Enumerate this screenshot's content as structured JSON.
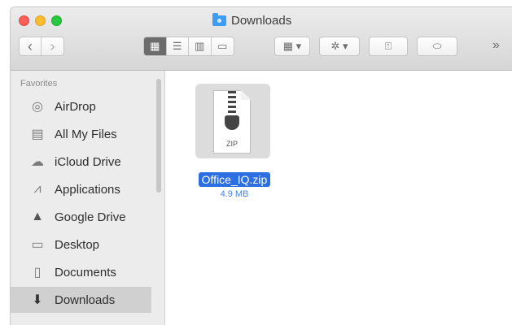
{
  "window": {
    "title": "Downloads"
  },
  "toolbar": {
    "back_icon": "chevron-left-icon",
    "forward_icon": "chevron-right-icon",
    "view_modes": [
      "icon-view",
      "list-view",
      "column-view",
      "cover-flow-view"
    ],
    "active_view": "icon-view",
    "overflow_icon": "double-chevron-right-icon",
    "glyphs": {
      "back": "‹",
      "forward": "›",
      "icon_view": "▦",
      "list_view": "☰",
      "column_view": "▥",
      "cover_view": "▭",
      "group": "▦ ▾",
      "action": "✲ ▾",
      "share": "⍐",
      "tag": "⬭",
      "overflow": "»"
    }
  },
  "sidebar": {
    "heading": "Favorites",
    "items": [
      {
        "label": "AirDrop",
        "icon": "airdrop-icon",
        "glyph": "◎"
      },
      {
        "label": "All My Files",
        "icon": "all-files-icon",
        "glyph": "▤"
      },
      {
        "label": "iCloud Drive",
        "icon": "cloud-icon",
        "glyph": "☁"
      },
      {
        "label": "Applications",
        "icon": "applications-icon",
        "glyph": "⩘"
      },
      {
        "label": "Google Drive",
        "icon": "google-drive-icon",
        "glyph": "▲"
      },
      {
        "label": "Desktop",
        "icon": "desktop-icon",
        "glyph": "▭"
      },
      {
        "label": "Documents",
        "icon": "documents-icon",
        "glyph": "▯"
      },
      {
        "label": "Downloads",
        "icon": "downloads-icon",
        "glyph": "⬇",
        "selected": true
      }
    ]
  },
  "files": [
    {
      "name": "Office_IQ.zip",
      "size": "4.9 MB",
      "type_label": "ZIP",
      "icon": "zip-file-icon",
      "selected": true
    }
  ],
  "colors": {
    "selection": "#2b6fe3",
    "size_text": "#4a84e3",
    "sidebar_bg": "#ececec",
    "sidebar_selected": "#d0d0d0"
  }
}
